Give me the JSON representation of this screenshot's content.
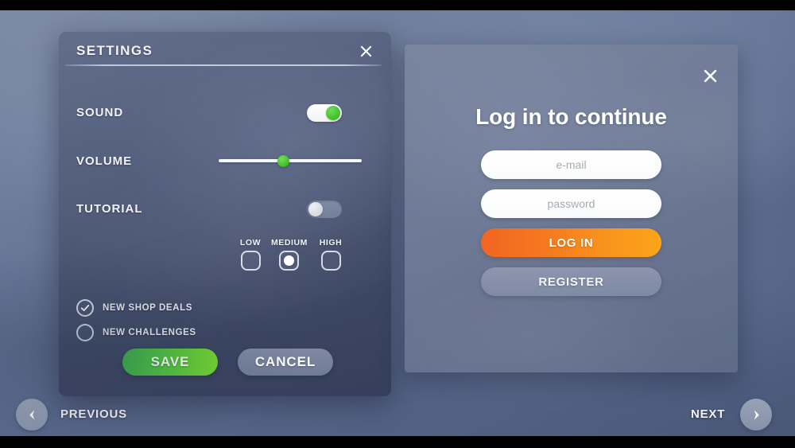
{
  "settings": {
    "title": "SETTINGS",
    "close_icon": "close-icon",
    "rows": {
      "sound": {
        "label": "SOUND",
        "toggle_state": "on"
      },
      "volume": {
        "label": "VOLUME",
        "value_percent": 45
      },
      "tutorial": {
        "label": "TUTORIAL",
        "toggle_state": "off"
      }
    },
    "difficulty": {
      "options": [
        {
          "label": "LOW",
          "selected": false
        },
        {
          "label": "MEDIUM",
          "selected": true
        },
        {
          "label": "HIGH",
          "selected": false
        }
      ]
    },
    "checkboxes": [
      {
        "label": "NEW SHOP DEALS",
        "checked": true
      },
      {
        "label": "NEW CHALLENGES",
        "checked": false
      }
    ],
    "buttons": {
      "save": "SAVE",
      "cancel": "CANCEL"
    },
    "scrollbar": {
      "visible": true
    }
  },
  "login": {
    "close_icon": "close-icon",
    "heading": "Log in to continue",
    "email": {
      "value": "",
      "placeholder": "e-mail"
    },
    "password": {
      "value": "",
      "placeholder": "password"
    },
    "buttons": {
      "login": "LOG IN",
      "register": "REGISTER"
    }
  },
  "nav": {
    "previous": {
      "label": "PREVIOUS",
      "icon": "chevron-left-icon"
    },
    "next": {
      "label": "NEXT",
      "icon": "chevron-right-icon"
    }
  },
  "colors": {
    "accent_green": "#52c83e",
    "accent_orange": "#f47920",
    "panel_muted": "#808ba6",
    "text_light": "#f1f3f8"
  }
}
